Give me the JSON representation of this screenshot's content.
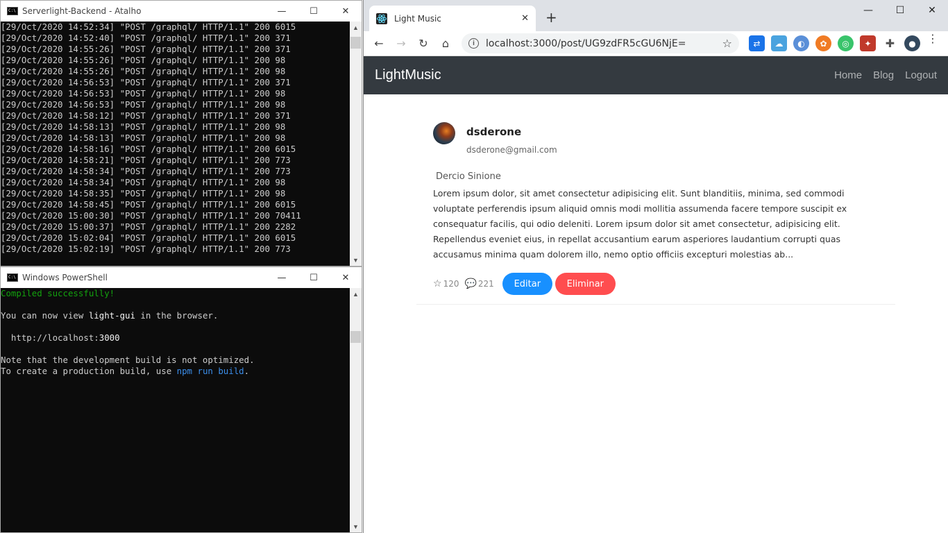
{
  "console1": {
    "title": "Serverlight-Backend - Atalho",
    "lines": [
      "[29/Oct/2020 14:52:34] \"POST /graphql/ HTTP/1.1\" 200 6015",
      "[29/Oct/2020 14:52:40] \"POST /graphql/ HTTP/1.1\" 200 371",
      "[29/Oct/2020 14:55:26] \"POST /graphql/ HTTP/1.1\" 200 371",
      "[29/Oct/2020 14:55:26] \"POST /graphql/ HTTP/1.1\" 200 98",
      "[29/Oct/2020 14:55:26] \"POST /graphql/ HTTP/1.1\" 200 98",
      "[29/Oct/2020 14:56:53] \"POST /graphql/ HTTP/1.1\" 200 371",
      "[29/Oct/2020 14:56:53] \"POST /graphql/ HTTP/1.1\" 200 98",
      "[29/Oct/2020 14:56:53] \"POST /graphql/ HTTP/1.1\" 200 98",
      "[29/Oct/2020 14:58:12] \"POST /graphql/ HTTP/1.1\" 200 371",
      "[29/Oct/2020 14:58:13] \"POST /graphql/ HTTP/1.1\" 200 98",
      "[29/Oct/2020 14:58:13] \"POST /graphql/ HTTP/1.1\" 200 98",
      "[29/Oct/2020 14:58:16] \"POST /graphql/ HTTP/1.1\" 200 6015",
      "[29/Oct/2020 14:58:21] \"POST /graphql/ HTTP/1.1\" 200 773",
      "[29/Oct/2020 14:58:34] \"POST /graphql/ HTTP/1.1\" 200 773",
      "[29/Oct/2020 14:58:34] \"POST /graphql/ HTTP/1.1\" 200 98",
      "[29/Oct/2020 14:58:35] \"POST /graphql/ HTTP/1.1\" 200 98",
      "[29/Oct/2020 14:58:45] \"POST /graphql/ HTTP/1.1\" 200 6015",
      "[29/Oct/2020 15:00:30] \"POST /graphql/ HTTP/1.1\" 200 70411",
      "[29/Oct/2020 15:00:37] \"POST /graphql/ HTTP/1.1\" 200 2282",
      "[29/Oct/2020 15:02:04] \"POST /graphql/ HTTP/1.1\" 200 6015",
      "[29/Oct/2020 15:02:19] \"POST /graphql/ HTTP/1.1\" 200 773"
    ]
  },
  "console2": {
    "title": "Windows PowerShell",
    "compiled": "Compiled successfully!",
    "view_prefix": "You can now view ",
    "view_app": "light-gui",
    "view_suffix": " in the browser.",
    "local_prefix": "  http://localhost:",
    "local_port": "3000",
    "note": "Note that the development build is not optimized.",
    "build_prefix": "To create a production build, use ",
    "build_cmd": "npm run build",
    "build_suffix": "."
  },
  "window_controls": {
    "minimize": "—",
    "maximize": "☐",
    "close": "✕"
  },
  "browser": {
    "tab_title": "Light Music",
    "tab_close": "✕",
    "new_tab": "+",
    "url": "localhost:3000/post/UG9zdFR5cGU6NjE=",
    "back": "←",
    "forward": "→",
    "reload": "↻",
    "home": "⌂",
    "star": "☆",
    "menu": "⋮"
  },
  "app": {
    "brand": "LightMusic",
    "nav": [
      "Home",
      "Blog",
      "Logout"
    ],
    "post": {
      "username": "dsderone",
      "email": "dsderone@gmail.com",
      "title": "Dercio Sinione",
      "text": "Lorem ipsum dolor, sit amet consectetur adipisicing elit. Sunt blanditiis, minima, sed commodi voluptate perferendis ipsum aliquid omnis modi mollitia assumenda facere tempore suscipit ex consequatur facilis, qui odio deleniti. Lorem ipsum dolor sit amet consectetur, adipisicing elit. Repellendus eveniet eius, in repellat accusantium earum asperiores laudantium corrupti quas accusamus minima quam dolorem illo, nemo optio officiis excepturi molestias ab...",
      "likes": "120",
      "comments": "221",
      "edit_label": "Editar",
      "delete_label": "Eliminar"
    }
  },
  "colors": {
    "navbar": "#343a40",
    "edit_button": "#1890ff",
    "delete_button": "#ff4d4f",
    "console_bg": "#0c0c0c"
  }
}
